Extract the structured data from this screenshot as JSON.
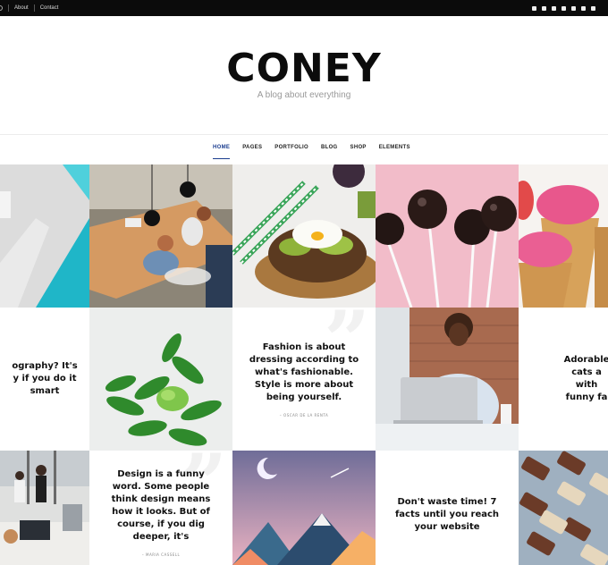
{
  "topbar": {
    "links": [
      "About",
      "Contact"
    ],
    "social_icons": [
      "facebook-icon",
      "instagram-icon",
      "pinterest-icon",
      "youtube-icon",
      "vimeo-icon",
      "email-icon",
      "rss-icon"
    ]
  },
  "header": {
    "logo": "CONEY",
    "tagline": "A blog about everything"
  },
  "nav": {
    "items": [
      "HOME",
      "PAGES",
      "PORTFOLIO",
      "BLOG",
      "SHOP",
      "ELEMENTS"
    ],
    "active": "HOME"
  },
  "quotes": {
    "q1": "ography? It's\ny if you do it\nsmart",
    "q2": {
      "text": "Fashion is about\ndressing according to\nwhat's fashionable.\nStyle is more about\nbeing yourself.",
      "author": "– OSCAR DE LA RENTA"
    },
    "q3": "Adorable cats a\nwith funny fa",
    "q4": {
      "text": "Design is a funny\nword. Some people\nthink design means\nhow it looks. But of\ncourse, if you dig\ndeeper, it's",
      "author": "– MARIA CASSELL"
    },
    "q5": "Don't waste time! 7\nfacts until you reach\nyour website"
  },
  "colors": {
    "accent": "#1b3d8f",
    "topbar": "#0b0b0b",
    "pink": "#f2bcc9",
    "teal": "#2ec3cf"
  }
}
